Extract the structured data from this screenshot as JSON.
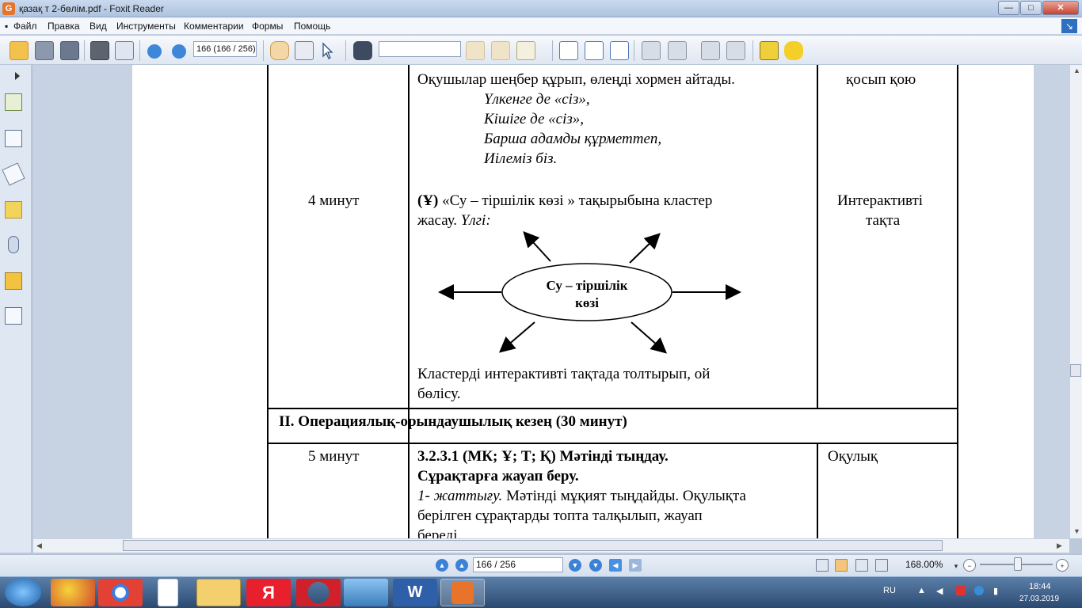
{
  "window": {
    "title": "қазақ т 2-бөлім.pdf - Foxit Reader",
    "app_icon_letter": "G",
    "buttons": {
      "minimize": "—",
      "maximize": "□",
      "close": "✕"
    }
  },
  "menu": {
    "items": [
      "Файл",
      "Правка",
      "Вид",
      "Инструменты",
      "Комментарии",
      "Формы",
      "Помощь"
    ],
    "restore_icon": "↘"
  },
  "toolbar": {
    "page_field": "166 (166 / 256)",
    "icons": [
      "open-folder-icon",
      "save-icon",
      "save-all-icon",
      "print-icon",
      "scan-icon",
      "previous-page-icon",
      "next-page-icon",
      "hand-tool-icon",
      "select-text-icon",
      "select-arrow-icon",
      "binoculars-icon",
      "find-prev-icon",
      "find-next-icon",
      "highlight-icon",
      "zoom-100-icon",
      "fit-page-icon",
      "fit-width-icon",
      "pdf-create-icon",
      "pdf-convert-icon",
      "pdf-export-icon",
      "pdf-combine-icon",
      "typewriter-icon",
      "note-icon"
    ]
  },
  "document": {
    "row1": {
      "time": "4 минут",
      "top_text": "Оқушылар шеңбер құрып, өлеңді хормен айтады.",
      "poem": [
        "Үлкенге де «сіз»,",
        "Кішіге де «сіз»,",
        "Барша адамды құрметтеп,",
        "Иілеміз біз."
      ],
      "task_marker": "(Ұ)",
      "task_text": " «Су – тіршілік көзі » тақырыбына кластер",
      "task_text2": "жасау. ",
      "task_sample": "Үлгі:",
      "cluster_line1": "Су – тіршілік",
      "cluster_line2": "көзі",
      "bottom_text1": "Кластерді интерактивті тақтада толтырып, ой",
      "bottom_text2": "бөлісу.",
      "resources_top": "қосып қою",
      "resources1": "Интерактивті",
      "resources2": "тақта"
    },
    "section_heading": "II. Операциялық-орындаушылық кезең  (30 минут)",
    "row2": {
      "time": "5 минут",
      "title1": "3.2.3.1 (МК; Ұ; Т; Қ) Мәтінді тыңдау.",
      "title2": "Сұрақтарға жауап беру.",
      "exercise_label": "1- жаттығу.",
      "exercise_text": " Мәтінді мұқият тыңдайды. Оқулықта",
      "line3": "берілген сұрақтарды топта талқылып, жауап",
      "line4": "береді.",
      "resource": "Оқулық"
    }
  },
  "statusbar": {
    "page_box": "166 / 256",
    "zoom": "168.00%",
    "zoom_level_fraction": 0.52,
    "zoom_minus": "−",
    "zoom_plus": "+"
  },
  "taskbar": {
    "language": "RU",
    "time": "18:44",
    "date": "27.03.2019",
    "apps": [
      "start-orb-icon",
      "paint-icon",
      "chrome-icon",
      "blank-document-icon",
      "file-explorer-icon",
      "yandex-browser-icon",
      "opera-icon",
      "photo-viewer-icon",
      "word-icon",
      "foxit-reader-icon"
    ],
    "yandex_letter": "Я",
    "word_letters": "W"
  }
}
